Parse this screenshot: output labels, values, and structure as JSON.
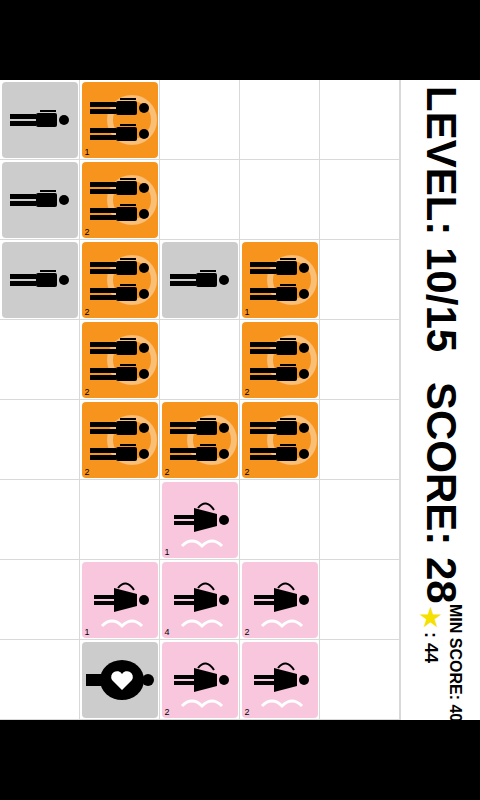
{
  "level": "LEVEL: 10/15",
  "score": "SCORE: 28",
  "min_score": "MIN SCORE: 40",
  "star": "★",
  "star_score": ": 44",
  "grid": [
    [
      {
        "kind": "man",
        "count": "",
        "color": "#cccccc"
      },
      {
        "kind": "couple",
        "count": "1",
        "color": "#f7941d"
      },
      {
        "kind": "empty",
        "count": "",
        "color": "#ffffff"
      },
      {
        "kind": "empty",
        "count": "",
        "color": "#ffffff"
      },
      {
        "kind": "empty",
        "count": "",
        "color": "#ffffff"
      }
    ],
    [
      {
        "kind": "man",
        "count": "",
        "color": "#cccccc"
      },
      {
        "kind": "couple",
        "count": "2",
        "color": "#f7941d"
      },
      {
        "kind": "empty",
        "count": "",
        "color": "#ffffff"
      },
      {
        "kind": "empty",
        "count": "",
        "color": "#ffffff"
      },
      {
        "kind": "empty",
        "count": "",
        "color": "#ffffff"
      }
    ],
    [
      {
        "kind": "man",
        "count": "",
        "color": "#cccccc"
      },
      {
        "kind": "couple",
        "count": "2",
        "color": "#f7941d"
      },
      {
        "kind": "man",
        "count": "",
        "color": "#cccccc"
      },
      {
        "kind": "couple",
        "count": "1",
        "color": "#f7941d"
      },
      {
        "kind": "empty",
        "count": "",
        "color": "#ffffff"
      }
    ],
    [
      {
        "kind": "empty",
        "count": "",
        "color": "#ffffff"
      },
      {
        "kind": "couple",
        "count": "2",
        "color": "#f7941d"
      },
      {
        "kind": "empty",
        "count": "",
        "color": "#ffffff"
      },
      {
        "kind": "couple",
        "count": "2",
        "color": "#f7941d"
      },
      {
        "kind": "empty",
        "count": "",
        "color": "#ffffff"
      }
    ],
    [
      {
        "kind": "empty",
        "count": "",
        "color": "#ffffff"
      },
      {
        "kind": "couple",
        "count": "2",
        "color": "#f7941d"
      },
      {
        "kind": "couple",
        "count": "2",
        "color": "#f7941d"
      },
      {
        "kind": "couple",
        "count": "2",
        "color": "#f7941d"
      },
      {
        "kind": "empty",
        "count": "",
        "color": "#ffffff"
      }
    ],
    [
      {
        "kind": "empty",
        "count": "",
        "color": "#ffffff"
      },
      {
        "kind": "empty",
        "count": "",
        "color": "#ffffff"
      },
      {
        "kind": "bride",
        "count": "1",
        "color": "#f8c6dd"
      },
      {
        "kind": "empty",
        "count": "",
        "color": "#ffffff"
      },
      {
        "kind": "empty",
        "count": "",
        "color": "#ffffff"
      }
    ],
    [
      {
        "kind": "empty",
        "count": "",
        "color": "#ffffff"
      },
      {
        "kind": "bride",
        "count": "1",
        "color": "#f8c6dd"
      },
      {
        "kind": "bride",
        "count": "4",
        "color": "#f8c6dd"
      },
      {
        "kind": "bride",
        "count": "2",
        "color": "#f8c6dd"
      },
      {
        "kind": "empty",
        "count": "",
        "color": "#ffffff"
      }
    ],
    [
      {
        "kind": "empty",
        "count": "",
        "color": "#ffffff"
      },
      {
        "kind": "heart",
        "count": "",
        "color": "#cccccc"
      },
      {
        "kind": "bride",
        "count": "2",
        "color": "#f8c6dd"
      },
      {
        "kind": "bride",
        "count": "2",
        "color": "#f8c6dd"
      },
      {
        "kind": "empty",
        "count": "",
        "color": "#ffffff"
      }
    ]
  ]
}
